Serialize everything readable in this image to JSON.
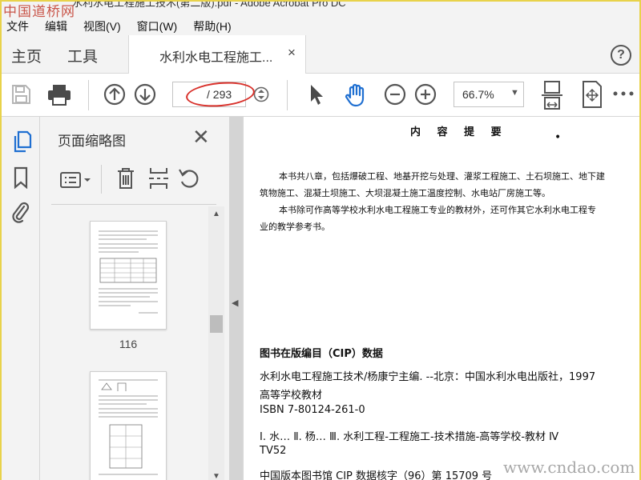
{
  "window": {
    "title_fragment": "水利水电工程施工技术(第二版).pdf - Adobe Acrobat Pro DC",
    "watermark_top": "中国道桥网",
    "watermark_bottom": "www.cndao.com"
  },
  "menu": [
    "文件",
    "编辑",
    "视图(V)",
    "窗口(W)",
    "帮助(H)"
  ],
  "tabs": {
    "home": "主页",
    "tools": "工具",
    "document": "水利水电工程施工...",
    "close": "×",
    "help": "?"
  },
  "toolbar": {
    "current_page": "",
    "total_pages": "/ 293",
    "zoom": "66.7%",
    "zoom_dropdown": "▼",
    "highlight_color": "#d8302a"
  },
  "thumbnails_panel": {
    "title": "页面缩略图",
    "close": "✕",
    "scroll_up": "▲",
    "scroll_down": "▼",
    "collapse": "◀",
    "pages": [
      {
        "label": "116"
      },
      {
        "label": ""
      }
    ]
  },
  "page_content": {
    "title": "内 容 提 要",
    "dot": "•",
    "para1_line1": "本书共八章，包括爆破工程、地基开挖与处理、灌浆工程施工、土石坝施工、地下建",
    "para1_line2": "筑物施工、混凝土坝施工、大坝混凝土施工温度控制、水电站厂房施工等。",
    "para2_line1": "本书除可作高等学校水利水电工程施工专业的教材外，还可作其它水利水电工程专",
    "para2_line2": "业的教学参考书。",
    "cip_heading": "图书在版编目（CIP）数据",
    "cip_line1": "水利水电工程施工技术/杨康宁主编. --北京：中国水利水电出版社，1997",
    "cip_line2": "高等学校教材",
    "cip_line3": "ISBN 7-80124-261-0",
    "cip_line4": "Ⅰ. 水… Ⅱ. 杨… Ⅲ. 水利工程-工程施工-技术措施-高等学校-教材  Ⅳ",
    "cip_line5": "TV52",
    "cip_line6": "中国版本图书馆 CIP 数据核字（96）第 15709 号"
  }
}
